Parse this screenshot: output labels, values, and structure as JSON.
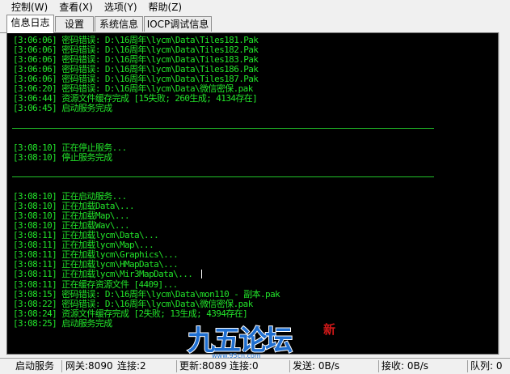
{
  "menu": [
    {
      "label": "控制(W)"
    },
    {
      "label": "查看(X)"
    },
    {
      "label": "选项(Y)"
    },
    {
      "label": "帮助(Z)"
    }
  ],
  "tabs": [
    {
      "label": "信息日志",
      "active": true
    },
    {
      "label": "设置",
      "active": false
    },
    {
      "label": "系统信息",
      "active": false
    },
    {
      "label": "IOCP调试信息",
      "active": false
    }
  ],
  "log": [
    "[3:06:06] 密码错误: D:\\16周年\\lycm\\Data\\Tiles181.Pak",
    "[3:06:06] 密码错误: D:\\16周年\\lycm\\Data\\Tiles182.Pak",
    "[3:06:06] 密码错误: D:\\16周年\\lycm\\Data\\Tiles183.Pak",
    "[3:06:06] 密码错误: D:\\16周年\\lycm\\Data\\Tiles186.Pak",
    "[3:06:06] 密码错误: D:\\16周年\\lycm\\Data\\Tiles187.Pak",
    "[3:06:20] 密码错误: D:\\16周年\\lycm\\Data\\微信密保.pak",
    "[3:06:44] 资源文件缓存完成 [15失败; 260生成; 4134存在]",
    "[3:06:45] 启动服务完成",
    "",
    "---",
    "",
    "[3:08:10] 正在停止服务...",
    "[3:08:10] 停止服务完成",
    "",
    "---",
    "",
    "[3:08:10] 正在启动服务...",
    "[3:08:10] 正在加载Data\\...",
    "[3:08:10] 正在加载Map\\...",
    "[3:08:10] 正在加载Wav\\...",
    "[3:08:11] 正在加载lycm\\Data\\...",
    "[3:08:11] 正在加载lycm\\Map\\...",
    "[3:08:11] 正在加载lycm\\Graphics\\...",
    "[3:08:11] 正在加载lycm\\HMapData\\...",
    "[3:08:11] 正在加载lycm\\Mir3MapData\\...",
    "[3:08:11] 正在缓存资源文件 [4409]...",
    "[3:08:15] 密码错误: D:\\16周年\\lycm\\Data\\mon110 - 副本.pak",
    "[3:08:22] 密码错误: D:\\16周年\\lycm\\Data\\微信密保.pak",
    "[3:08:24] 资源文件缓存完成 [2失败; 13生成; 4394存在]",
    "[3:08:25] 启动服务完成"
  ],
  "status": {
    "state": "启动服务",
    "gateway": "网关:8090",
    "connections": "连接:2",
    "update": "更新:8089",
    "update_tail": "连接:0",
    "send": "发送: 0B/s",
    "recv": "接收: 0B/s",
    "queue": "队列: 0"
  },
  "logo": {
    "text": "九五论坛",
    "badge": "新",
    "url": "www.95cn.com"
  },
  "colors": {
    "console_bg": "#000000",
    "log_text": "#22e32a",
    "logo_blue": "#1f6fd1"
  }
}
